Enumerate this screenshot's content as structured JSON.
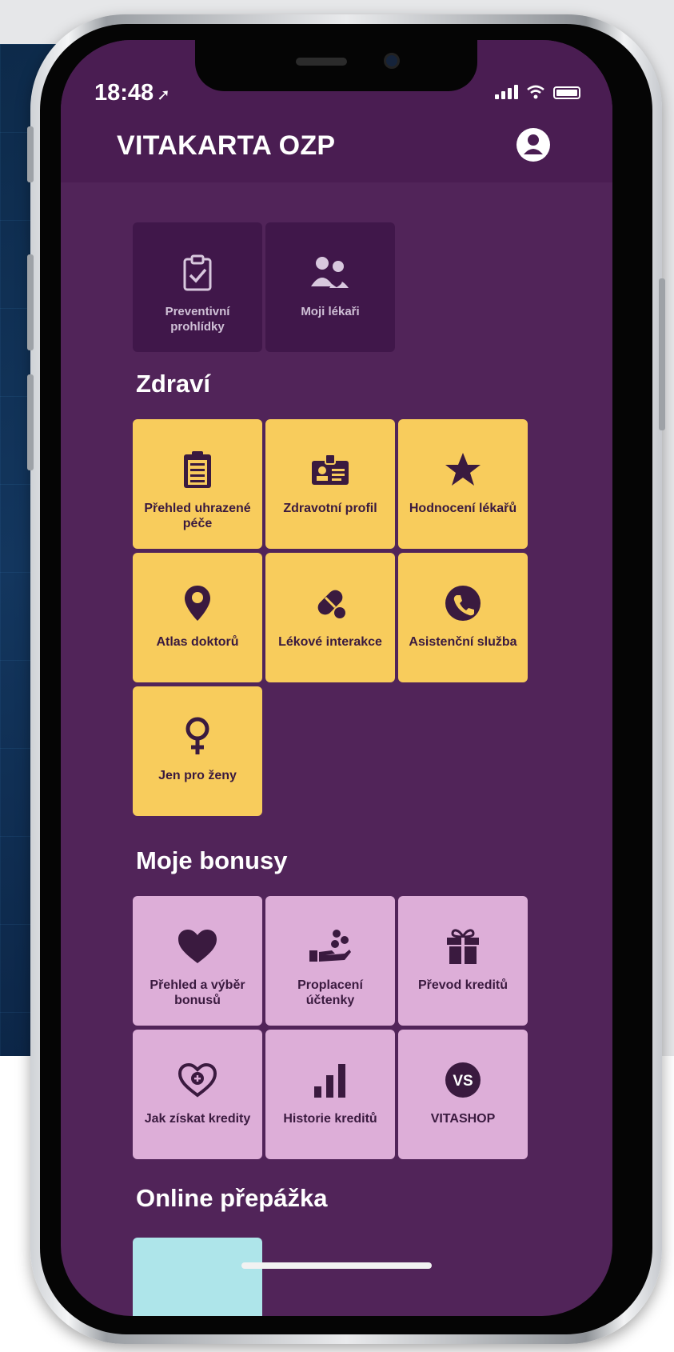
{
  "status_bar": {
    "time": "18:48",
    "location_arrow": "location-arrow-icon"
  },
  "header": {
    "title": "VITAKARTA OZP",
    "profile_icon": "user-icon"
  },
  "top_tiles": [
    {
      "label": "Preventivní prohlídky",
      "icon": "clipboard-check-icon"
    },
    {
      "label": "Moji lékaři",
      "icon": "doctors-icon"
    }
  ],
  "health": {
    "title": "Zdraví",
    "tiles": [
      {
        "label": "Přehled uhrazené péče",
        "icon": "clipboard-list-icon"
      },
      {
        "label": "Zdravotní profil",
        "icon": "id-badge-icon"
      },
      {
        "label": "Hodnocení lékařů",
        "icon": "star-icon"
      },
      {
        "label": "Atlas doktorů",
        "icon": "map-pin-icon"
      },
      {
        "label": "Lékové interakce",
        "icon": "pills-icon"
      },
      {
        "label": "Asistenční služba",
        "icon": "phone-call-icon"
      },
      {
        "label": "Jen pro ženy",
        "icon": "female-icon"
      }
    ]
  },
  "bonuses": {
    "title": "Moje bonusy",
    "tiles": [
      {
        "label": "Přehled a výběr bonusů",
        "icon": "heart-icon"
      },
      {
        "label": "Proplacení účtenky",
        "icon": "hand-coins-icon"
      },
      {
        "label": "Převod kreditů",
        "icon": "gift-icon"
      },
      {
        "label": "Jak získat kredity",
        "icon": "heart-plus-icon"
      },
      {
        "label": "Historie kreditů",
        "icon": "bar-chart-icon"
      },
      {
        "label": "VITASHOP",
        "icon": "vs-badge-icon",
        "badge_text": "VS"
      }
    ]
  },
  "online": {
    "title": "Online přepážka"
  },
  "colors": {
    "purple": "#512459",
    "header": "#4a1d52",
    "yellow": "#f8cc5c",
    "pink": "#ddaed8",
    "dark_tile": "#40174a",
    "icon": "#3a1a3f"
  }
}
